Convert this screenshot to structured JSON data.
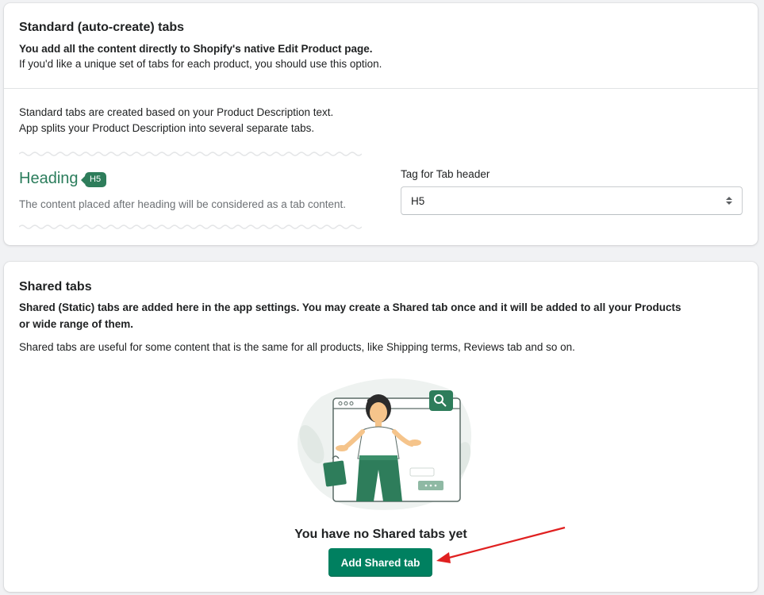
{
  "standard": {
    "title": "Standard (auto-create) tabs",
    "bold_line": "You add all the content directly to Shopify's native Edit Product page.",
    "hint": "If you'd like a unique set of tabs for each product, you should use this option.",
    "desc_line1": "Standard tabs are created based on your Product Description text.",
    "desc_line2": "App splits your Product Description into several separate tabs.",
    "heading_word": "Heading",
    "heading_badge": "H5",
    "heading_note": "The content placed after heading will be considered as a tab content.",
    "tag_label": "Tag for Tab header",
    "tag_value": "H5"
  },
  "shared": {
    "title": "Shared tabs",
    "bold_line1": "Shared (Static) tabs are added here in the app settings. You may create a Shared tab once and it will be added to all your Products",
    "bold_line2": "or wide range of them.",
    "desc": "Shared tabs are useful for some content that is the same for all products, like Shipping terms, Reviews tab and so on.",
    "empty_title": "You have no Shared tabs yet",
    "add_button": "Add Shared tab"
  },
  "colors": {
    "primary": "#008060",
    "accent_green": "#2b7d5c",
    "annotation_arrow": "#e02020"
  },
  "icons": [
    "sort-arrows-icon",
    "search-icon",
    "empty-state-illustration"
  ]
}
